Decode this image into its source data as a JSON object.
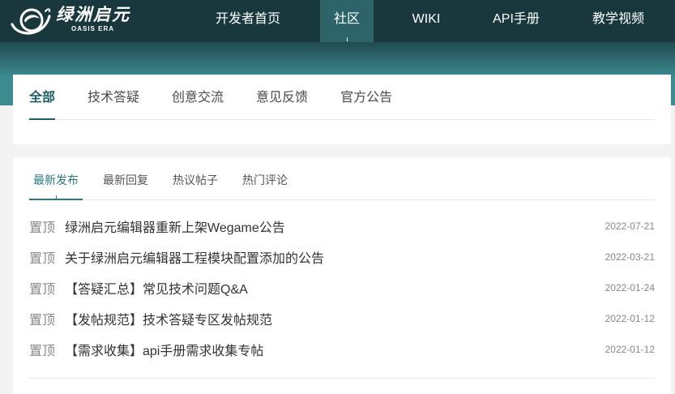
{
  "colors": {
    "nav_bg": "#18383d",
    "nav_active_bg": "#2c6469",
    "band_top": "#1f4a50",
    "band_bottom": "#3b8b8f",
    "page_bg": "#f3f3f3",
    "accent": "#2b7a80",
    "accent_dark": "#1f5e64",
    "text_main": "#333333",
    "text_muted": "#888888",
    "tab_text": "#4a4a4a",
    "divider": "#e6e6e6"
  },
  "header": {
    "logo": {
      "icon": "oasis-emblem-icon",
      "name": "绿洲启元",
      "subname": "OASIS ERA"
    },
    "nav": [
      {
        "label": "开发者首页",
        "active": false
      },
      {
        "label": "社区",
        "active": true
      },
      {
        "label": "WIKI",
        "active": false
      },
      {
        "label": "API手册",
        "active": false
      },
      {
        "label": "教学视频",
        "active": false
      }
    ]
  },
  "category_tabs": [
    {
      "label": "全部",
      "active": true
    },
    {
      "label": "技术答疑",
      "active": false
    },
    {
      "label": "创意交流",
      "active": false
    },
    {
      "label": "意见反馈",
      "active": false
    },
    {
      "label": "官方公告",
      "active": false
    }
  ],
  "sort_tabs": [
    {
      "label": "最新发布",
      "active": true
    },
    {
      "label": "最新回复",
      "active": false
    },
    {
      "label": "热议帖子",
      "active": false
    },
    {
      "label": "热门评论",
      "active": false
    }
  ],
  "posts": [
    {
      "tag": "置顶",
      "title": "绿洲启元编辑器重新上架Wegame公告",
      "date": "2022-07-21"
    },
    {
      "tag": "置顶",
      "title": "关于绿洲启元编辑器工程模块配置添加的公告",
      "date": "2022-03-21"
    },
    {
      "tag": "置顶",
      "title": "【答疑汇总】常见技术问题Q&A",
      "date": "2022-01-24"
    },
    {
      "tag": "置顶",
      "title": "【发帖规范】技术答疑专区发帖规范",
      "date": "2022-01-12"
    },
    {
      "tag": "置顶",
      "title": "【需求收集】api手册需求收集专帖",
      "date": "2022-01-12"
    }
  ]
}
